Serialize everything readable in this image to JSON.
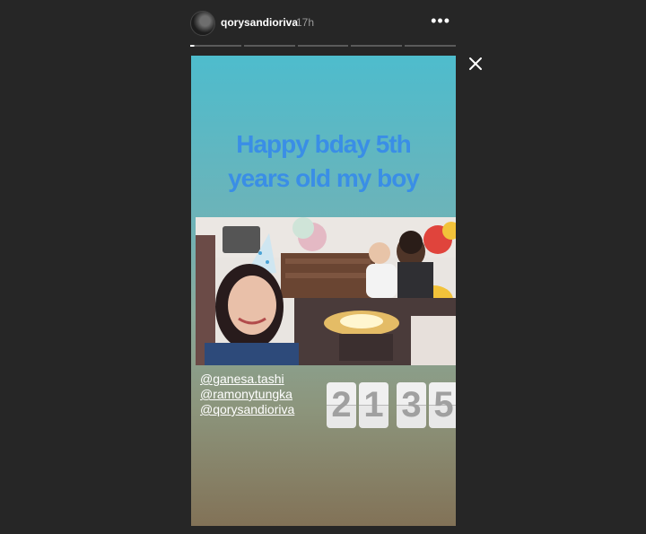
{
  "header": {
    "username": "qorysandioriva",
    "time": "17h",
    "more": "•••",
    "segments": 5,
    "active_segment": 1
  },
  "story": {
    "caption_line1": "Happy bday 5th",
    "caption_line2": "years old my boy",
    "mentions": [
      "@ganesa.tashi",
      "@ramonytungka",
      "@qorysandioriva"
    ],
    "counter_digits": [
      "2",
      "1",
      "3",
      "5"
    ],
    "photo": "birthday-party-photo"
  },
  "colors": {
    "background": "#262626",
    "caption": "#3a8ee6",
    "gradient_top": "#4ebccd",
    "gradient_bottom": "#827257"
  },
  "icons": {
    "close": "close-icon",
    "more": "more-options-icon"
  }
}
